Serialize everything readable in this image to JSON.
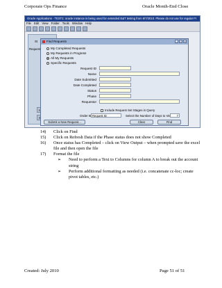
{
  "header": {
    "left": "Corporate Ops Finance",
    "right": "Oracle Month-End Close"
  },
  "footer": {
    "left": "Created: July 2010",
    "right": "Page 51 of 51"
  },
  "screenshot": {
    "title_bar": "Oracle Applications - TEST1: oracle instance is being used for extended E&T testing from 6/7/2010. Please do not use for regular FI",
    "menu": [
      "File",
      "Edit",
      "View",
      "Folder",
      "Tools",
      "Window",
      "Help"
    ],
    "background_window": {
      "label_s": "St",
      "label_request": "Request E",
      "button_h": "H",
      "button_s": "S"
    },
    "find_dialog": {
      "title": "Find Requests",
      "radios": [
        {
          "label": "My Completed Requests",
          "selected": false
        },
        {
          "label": "My Requests in Progress",
          "selected": false
        },
        {
          "label": "All My Requests",
          "selected": true
        },
        {
          "label": "Specific Requests",
          "selected": false
        }
      ],
      "fields": [
        {
          "label": "Request ID",
          "value": ""
        },
        {
          "label": "Name",
          "value": ""
        },
        {
          "label": "Date Submitted",
          "value": ""
        },
        {
          "label": "Date Completed",
          "value": ""
        },
        {
          "label": "Status",
          "value": ""
        },
        {
          "label": "Phase",
          "value": ""
        },
        {
          "label": "Requestor",
          "value": ""
        }
      ],
      "include_checkbox": "Include Request Set Stages in Query",
      "order_by_label": "Order By",
      "order_by_value": "Request ID",
      "days_label": "Select the Number of Days to View:",
      "days_value": "7",
      "buttons": {
        "submit": "Submit a New Request...",
        "clear": "Clear",
        "find": "Find"
      }
    }
  },
  "steps": [
    {
      "num": "14)",
      "text": "Click on Find"
    },
    {
      "num": "15)",
      "text": "Click on Refresh Data if the Phase status does not show Completed"
    },
    {
      "num": "16)",
      "text": "Once status has Completed – click on View Output – when prompted save the excel file and then open the file"
    },
    {
      "num": "17)",
      "text": "Format the file"
    }
  ],
  "substeps": [
    "Need to perform a Text to Columns for column A to break out the account string",
    "Perform additional formatting as needed (i.e. concatenate cc-loc; create pivot tables, etc.)"
  ]
}
